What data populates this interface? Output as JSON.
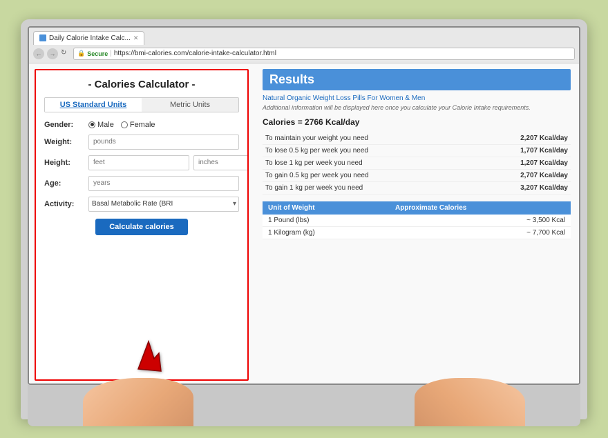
{
  "browser": {
    "tab_title": "Daily Calorie Intake Calc...",
    "url": "https://bmi-calories.com/calorie-intake-calculator.html",
    "secure_label": "Secure",
    "back_icon": "←",
    "forward_icon": "→",
    "refresh_icon": "↻"
  },
  "calculator": {
    "title": "- Calories Calculator -",
    "unit_tabs": [
      {
        "label": "US Standard Units",
        "active": true
      },
      {
        "label": "Metric Units",
        "active": false
      }
    ],
    "gender_label": "Gender:",
    "gender_options": [
      "Male",
      "Female"
    ],
    "weight_label": "Weight:",
    "weight_placeholder": "pounds",
    "height_label": "Height:",
    "height_placeholder1": "feet",
    "height_placeholder2": "inches",
    "age_label": "Age:",
    "age_placeholder": "years",
    "activity_label": "Activity:",
    "activity_value": "Basal Metabolic Rate (BRI",
    "calculate_btn": "Calculate calories"
  },
  "results": {
    "heading": "Results",
    "ad_link": "Natural Organic Weight Loss Pills For Women & Men",
    "ad_desc": "Additional information will be displayed here once you calculate your Calorie Intake requirements.",
    "calories_summary": "Calories = 2766 Kcal/day",
    "rows": [
      {
        "label": "To maintain your weight you need",
        "value": "2,207 Kcal/day"
      },
      {
        "label": "To lose 0.5 kg per week you need",
        "value": "1,707 Kcal/day"
      },
      {
        "label": "To lose 1 kg per week you need",
        "value": "1,207 Kcal/day"
      },
      {
        "label": "To gain 0.5 kg per week you need",
        "value": "2,707 Kcal/day"
      },
      {
        "label": "To gain 1 kg per week you need",
        "value": "3,207 Kcal/day"
      }
    ],
    "unit_table": {
      "headers": [
        "Unit of Weight",
        "Approximate Calories"
      ],
      "rows": [
        {
          "unit": "1 Pound (lbs)",
          "calories": "~ 3,500 Kcal"
        },
        {
          "unit": "1 Kilogram (kg)",
          "calories": "~ 7,700 Kcal"
        }
      ]
    }
  }
}
